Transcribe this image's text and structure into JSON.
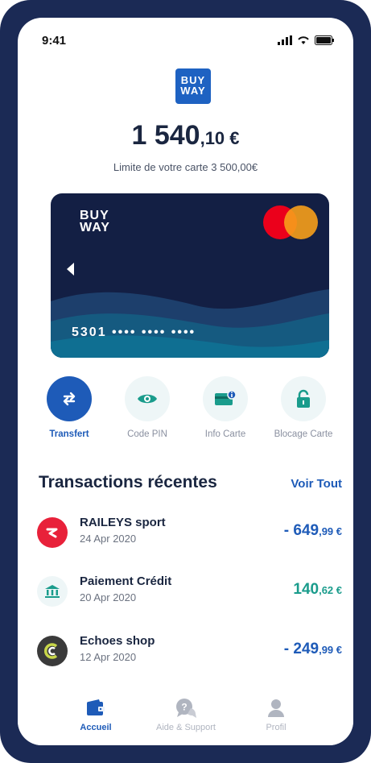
{
  "status_bar": {
    "time": "9:41"
  },
  "logo": {
    "line1": "BUY",
    "line2": "WAY"
  },
  "balance": {
    "integer": "1 540",
    "decimal": ",10 €"
  },
  "limit_text": "Limite de votre carte 3 500,00€",
  "card": {
    "brand_line1": "BUY",
    "brand_line2": "WAY",
    "number": "5301 •••• •••• ••••"
  },
  "actions": [
    {
      "label": "Transfert",
      "icon": "transfer-icon",
      "active": true
    },
    {
      "label": "Code PIN",
      "icon": "eye-icon",
      "active": false
    },
    {
      "label": "Info Carte",
      "icon": "card-info-icon",
      "active": false
    },
    {
      "label": "Blocage Carte",
      "icon": "lock-icon",
      "active": false
    }
  ],
  "transactions": {
    "title": "Transactions récentes",
    "see_all": "Voir Tout",
    "items": [
      {
        "name": "RAILEYS sport",
        "date": "24 Apr 2020",
        "amount_main": "- 649",
        "amount_small": ",99 €",
        "type": "debit",
        "icon": "raileys-logo-icon",
        "icon_color": "#e8213a"
      },
      {
        "name": "Paiement Crédit",
        "date": "20 Apr 2020",
        "amount_main": "140",
        "amount_small": ",62 €",
        "type": "credit",
        "icon": "bank-icon",
        "icon_color": "#eef6f7"
      },
      {
        "name": "Echoes shop",
        "date": "12 Apr 2020",
        "amount_main": "- 249",
        "amount_small": ",99 €",
        "type": "debit",
        "icon": "echoes-logo-icon",
        "icon_color": "#3a3a3a"
      }
    ]
  },
  "tabbar": [
    {
      "label": "Accueil",
      "icon": "wallet-icon",
      "active": true
    },
    {
      "label": "Aide & Support",
      "icon": "help-chat-icon",
      "active": false
    },
    {
      "label": "Profil",
      "icon": "user-icon",
      "active": false
    }
  ],
  "colors": {
    "primary": "#1e5bb8",
    "navy": "#1a2640",
    "teal": "#1a9c8c",
    "frame": "#1b2a55"
  }
}
